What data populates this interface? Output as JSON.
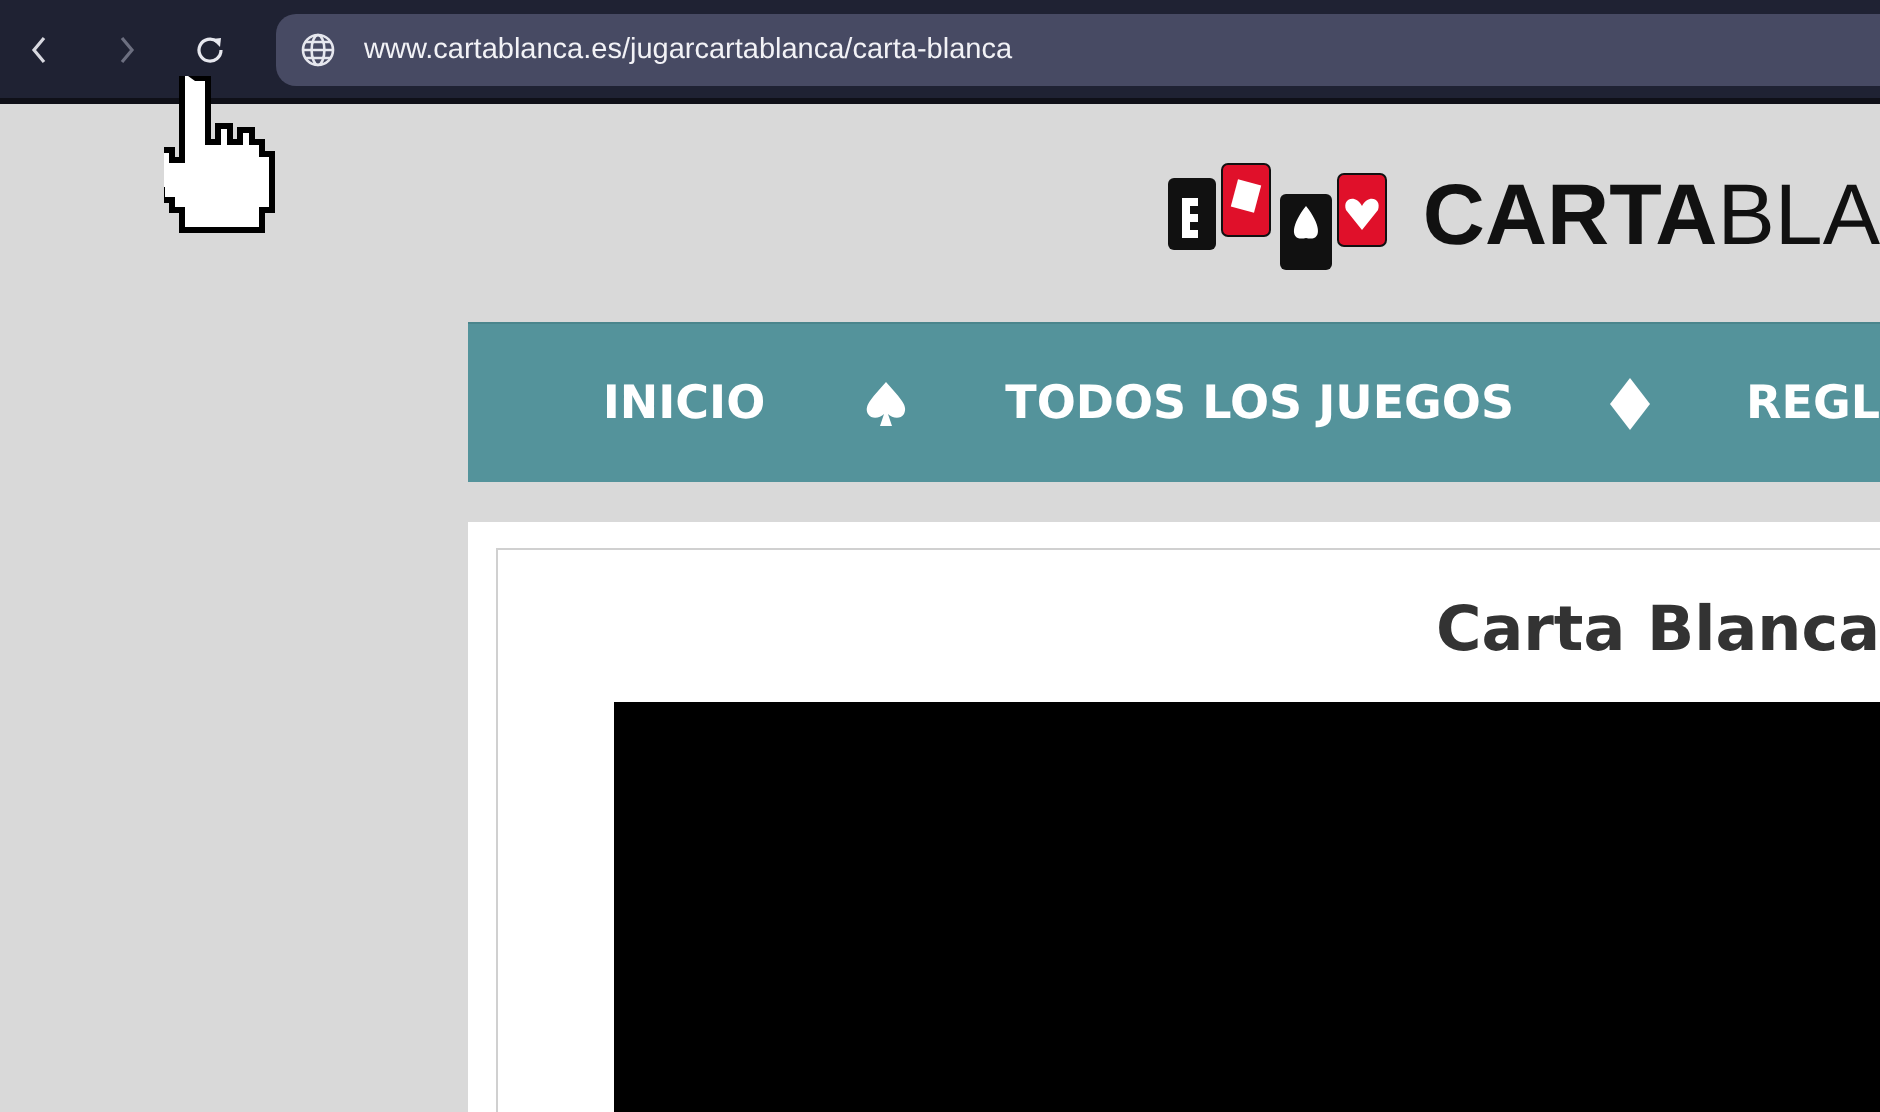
{
  "browser": {
    "url": "www.cartablanca.es/jugarcartablanca/carta-blanca"
  },
  "logo": {
    "text": "**CARTA**BLA"
  },
  "nav": {
    "items": [
      {
        "label": "INICIO"
      },
      {
        "label": "TODOS LOS JUEGOS"
      },
      {
        "label": "REGL"
      }
    ]
  },
  "article": {
    "title": "Carta Blanca"
  }
}
